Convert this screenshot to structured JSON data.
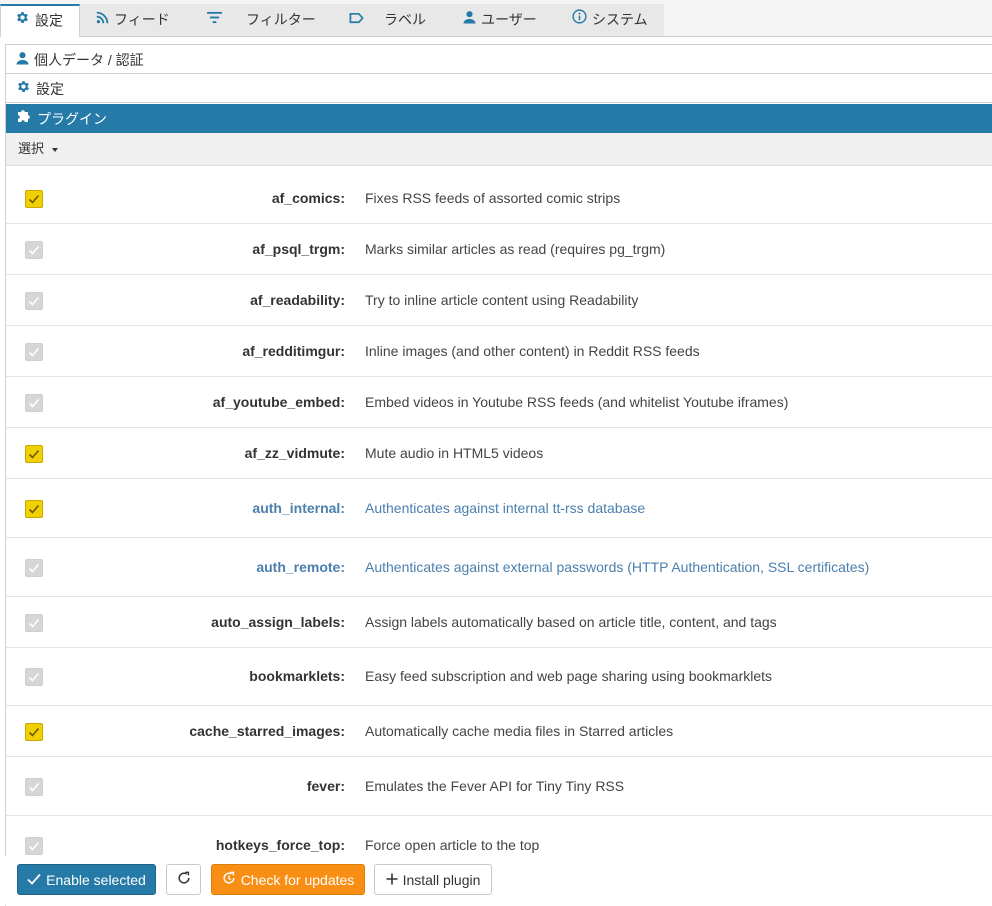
{
  "tabs": [
    {
      "label": "設定",
      "icon": "gear-icon",
      "active": true
    },
    {
      "label": "フィード",
      "icon": "rss-icon"
    },
    {
      "label": "フィルター",
      "icon": "filter-icon"
    },
    {
      "label": "ラベル",
      "icon": "label-icon"
    },
    {
      "label": "ユーザー",
      "icon": "user-icon"
    },
    {
      "label": "システム",
      "icon": "info-icon"
    }
  ],
  "accordion": {
    "personal": "個人データ / 認証",
    "settings": "設定",
    "plugins": "プラグイン"
  },
  "select_label": "選択",
  "plugins": [
    {
      "name": "af_comics:",
      "desc": "Fixes RSS feeds of assorted comic strips",
      "checked": true,
      "system": false
    },
    {
      "name": "af_psql_trgm:",
      "desc": "Marks similar articles as read (requires pg_trgm)",
      "checked": false,
      "system": false
    },
    {
      "name": "af_readability:",
      "desc": "Try to inline article content using Readability",
      "checked": false,
      "system": false
    },
    {
      "name": "af_redditimgur:",
      "desc": "Inline images (and other content) in Reddit RSS feeds",
      "checked": false,
      "system": false
    },
    {
      "name": "af_youtube_embed:",
      "desc": "Embed videos in Youtube RSS feeds (and whitelist Youtube iframes)",
      "checked": false,
      "system": false
    },
    {
      "name": "af_zz_vidmute:",
      "desc": "Mute audio in HTML5 videos",
      "checked": true,
      "system": false
    },
    {
      "name": "auth_internal:",
      "desc": "Authenticates against internal tt-rss database",
      "checked": true,
      "system": true
    },
    {
      "name": "auth_remote:",
      "desc": "Authenticates against external passwords (HTTP Authentication, SSL certificates)",
      "checked": false,
      "system": true
    },
    {
      "name": "auto_assign_labels:",
      "desc": "Assign labels automatically based on article title, content, and tags",
      "checked": false,
      "system": false
    },
    {
      "name": "bookmarklets:",
      "desc": "Easy feed subscription and web page sharing using bookmarklets",
      "checked": false,
      "system": false
    },
    {
      "name": "cache_starred_images:",
      "desc": "Automatically cache media files in Starred articles",
      "checked": true,
      "system": false
    },
    {
      "name": "fever:",
      "desc": "Emulates the Fever API for Tiny Tiny RSS",
      "checked": false,
      "system": false
    },
    {
      "name": "hotkeys_force_top:",
      "desc": "Force open article to the top",
      "checked": false,
      "system": false
    }
  ],
  "actions": {
    "enable_selected": "Enable selected",
    "check_updates": "Check for updates",
    "install_plugin": "Install plugin"
  },
  "colors": {
    "accent": "#257aa7",
    "checkbox_on": "#f0d000",
    "warn": "#f98e14",
    "system_text": "#4a7fae"
  }
}
